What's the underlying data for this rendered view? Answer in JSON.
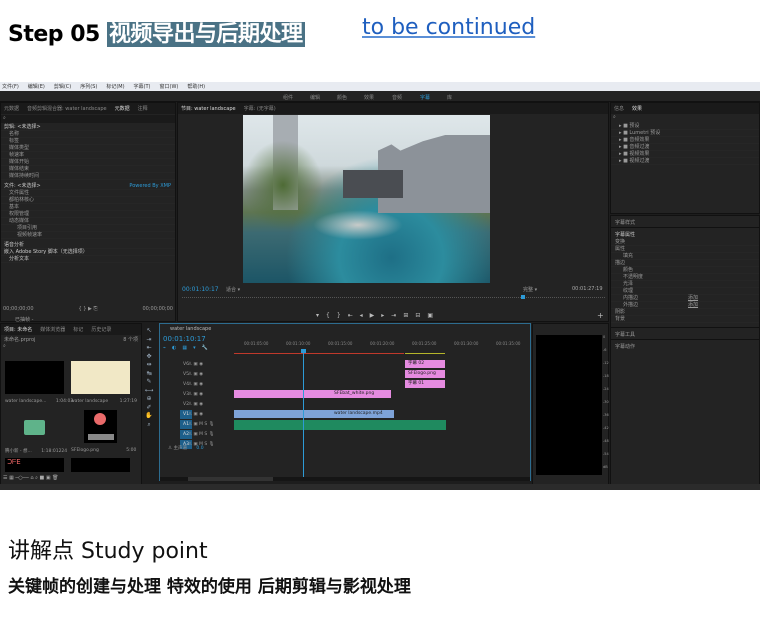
{
  "header": {
    "step": "Step 05",
    "title_highlight": "视频导出与后期处理",
    "link": "to be continued"
  },
  "app": {
    "menu": [
      "文件(F)",
      "编辑(E)",
      "剪辑(C)",
      "序列(S)",
      "标记(M)",
      "字幕(T)",
      "窗口(W)",
      "帮助(H)"
    ],
    "workspaces": [
      "组件",
      "编辑",
      "颜色",
      "效果",
      "音频",
      "字幕",
      "库"
    ],
    "metadata_panel": {
      "tabs": [
        "元数据",
        "音频剪辑混合器: water landscape",
        "元数据",
        "注释"
      ],
      "clip_header": "剪辑: <未选择>",
      "clip_rows": [
        "名称",
        "标签",
        "媒体类型",
        "帧速率",
        "媒体开始",
        "媒体结束",
        "媒体持续时间"
      ],
      "file_header": "文件: <未选择>",
      "file_rows": [
        "文件属性",
        "都柏林核心",
        "基本",
        "权限管理",
        "动态媒体",
        "项目引用",
        "视频帧速率"
      ],
      "speech": "语音分析",
      "embed": "嵌入 Adobe Story 脚本（无选择项）",
      "analyze": "分析文本",
      "powered": "Powered By XMP"
    },
    "source": {
      "timecode_in": "00;00;00;00",
      "timecode_out": "00;00;00;00",
      "status": "已抽帧 -"
    },
    "program": {
      "tab": "节目: water landscape",
      "caption_tab": "字幕: (无字幕)",
      "timecode": "00:01:10:17",
      "fit": "适合",
      "quality": "完整",
      "duration": "00:01:27:19"
    },
    "effects": {
      "tabs": [
        "信息",
        "效果"
      ],
      "items": [
        "预设",
        "Lumetri 预设",
        "音频效果",
        "音频过渡",
        "视频效果",
        "视频过渡"
      ]
    },
    "captions": {
      "style": "字幕样式",
      "props": "字幕属性",
      "rows": [
        "变换",
        "属性",
        "填充",
        "描边",
        "内描边",
        "外描边",
        "阴影",
        "背景",
        "颜色",
        "不透明度",
        "光泽",
        "纹理"
      ],
      "add": "添加",
      "tools": "字幕工具",
      "actions": "字幕动作"
    },
    "project": {
      "tabs": [
        "项目: 未命名",
        "媒体浏览器",
        "标记",
        "历史记录"
      ],
      "file": "未命名.prproj",
      "count": "8 个项",
      "items": [
        {
          "name": "water landscape...",
          "dur": "1:04:03"
        },
        {
          "name": "water landscape",
          "dur": "1:27:19"
        },
        {
          "name": "腾小新 - 想...",
          "dur": "1:18:01224"
        },
        {
          "name": "SFElogo.png",
          "dur": "5:00"
        }
      ]
    },
    "timeline": {
      "tab": "water landscape",
      "timecode": "00:01:10:17",
      "ruler": [
        "00:01:05:00",
        "00:01:10:00",
        "00:01:15:00",
        "00:01:20:00",
        "00:01:25:00",
        "00:01:30:00",
        "00:01:35:00"
      ],
      "tracks": [
        "V6",
        "V5",
        "V4",
        "V3",
        "V2",
        "V1",
        "A1",
        "A2",
        "A3"
      ],
      "master": "主声道",
      "master_val": "0.0",
      "clips": {
        "v3": "SFEbat_white.png",
        "v1": "water landscape.mp4",
        "c1": "字幕 02",
        "c2": "SFElogo.png",
        "c3": "字幕 01"
      }
    },
    "meter": [
      "0",
      "-6",
      "-12",
      "-18",
      "-24",
      "-30",
      "-36",
      "-42",
      "-48",
      "-54",
      "dB"
    ]
  },
  "study": {
    "heading": "讲解点 Study point",
    "points": "关键帧的创建与处理  特效的使用 后期剪辑与影视处理"
  }
}
